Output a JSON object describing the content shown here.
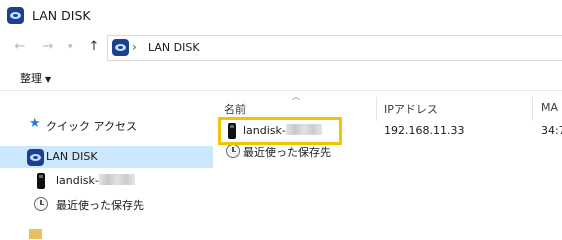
{
  "window": {
    "title": "LAN DISK"
  },
  "nav": {
    "address_path": "LAN DISK"
  },
  "ribbon": {
    "organize_label": "整理"
  },
  "sidebar": {
    "items": [
      {
        "label": "クイック アクセス",
        "icon": "quick-access-star-icon"
      },
      {
        "label": "LAN DISK",
        "icon": "lan-disk-icon",
        "selected": true
      },
      {
        "label": "landisk-",
        "icon": "device-icon"
      },
      {
        "label": "最近使った保存先",
        "icon": "recent-clock-icon"
      }
    ]
  },
  "columns": [
    {
      "label": "名前"
    },
    {
      "label": "IPアドレス"
    },
    {
      "label": "MA"
    }
  ],
  "rows": [
    {
      "name": "landisk-",
      "ip": "192.168.11.33",
      "mac": "34:7",
      "icon": "device-icon"
    },
    {
      "name": "最近使った保存先",
      "icon": "recent-clock-icon"
    }
  ],
  "colors": {
    "selected_bg": "#cce8ff",
    "highlight": "#f2c400",
    "accent": "#2b7bd6"
  }
}
